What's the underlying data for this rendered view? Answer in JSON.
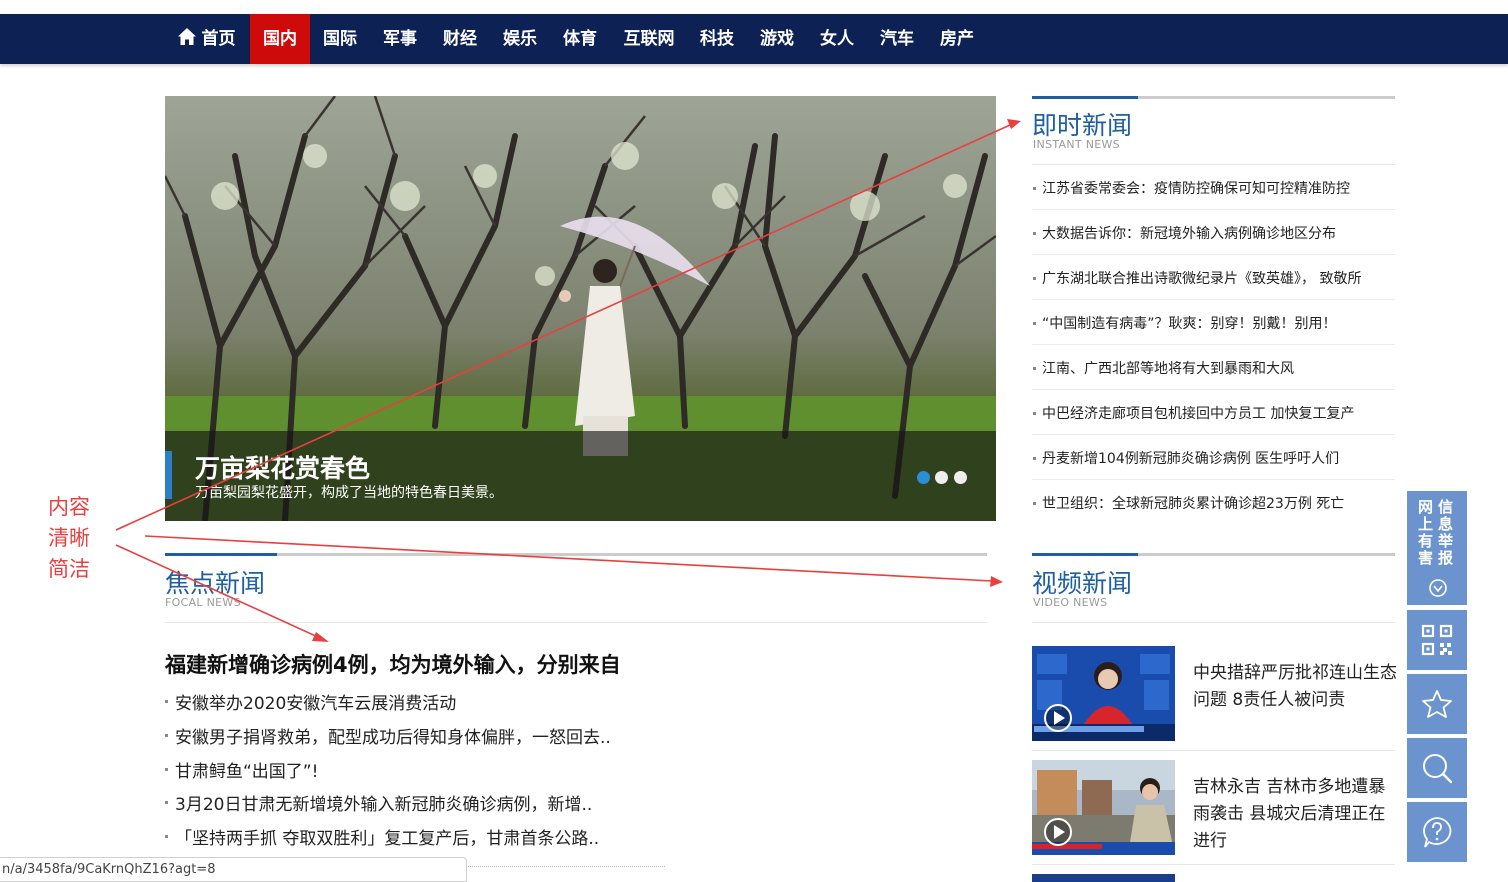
{
  "nav": {
    "items": [
      {
        "label": "首页",
        "active": false
      },
      {
        "label": "国内",
        "active": true
      },
      {
        "label": "国际",
        "active": false
      },
      {
        "label": "军事",
        "active": false
      },
      {
        "label": "财经",
        "active": false
      },
      {
        "label": "娱乐",
        "active": false
      },
      {
        "label": "体育",
        "active": false
      },
      {
        "label": "互联网",
        "active": false
      },
      {
        "label": "科技",
        "active": false
      },
      {
        "label": "游戏",
        "active": false
      },
      {
        "label": "女人",
        "active": false
      },
      {
        "label": "汽车",
        "active": false
      },
      {
        "label": "房产",
        "active": false
      }
    ],
    "bg_color": "#0d2155",
    "active_color": "#cf0a0a"
  },
  "hero": {
    "title": "万亩梨花赏春色",
    "subtitle": "万亩梨园梨花盛开，构成了当地的特色春日美景。",
    "slides_total": 3,
    "active_slide": 1
  },
  "instant": {
    "title": "即时新闻",
    "subtitle": "INSTANT NEWS",
    "items": [
      "江苏省委常委会：疫情防控确保可知可控精准防控",
      "大数据告诉你：新冠境外输入病例确诊地区分布",
      "广东湖北联合推出诗歌微纪录片《致英雄》， 致敬所",
      "“中国制造有病毒”？耿爽：别穿！别戴！别用！",
      "江南、广西北部等地将有大到暴雨和大风",
      "中巴经济走廊项目包机接回中方员工 加快复工复产",
      "丹麦新增104例新冠肺炎确诊病例 医生呼吁人们",
      "世卫组织：全球新冠肺炎累计确诊超23万例 死亡"
    ]
  },
  "focal": {
    "title": "焦点新闻",
    "subtitle": "FOCAL NEWS",
    "headline": "福建新增确诊病例4例，均为境外输入，分别来自",
    "items": [
      "安徽举办2020安徽汽车云展消费活动",
      "安徽男子捐肾救弟，配型成功后得知身体偏胖，一怒回去..",
      "甘肃鲟鱼“出国了”!",
      "3月20日甘肃无新增境外输入新冠肺炎确诊病例，新增..",
      "「坚持两手抓 夺取双胜利」复工复产后，甘肃首条公路.."
    ]
  },
  "video": {
    "title": "视频新闻",
    "subtitle": "VIDEO NEWS",
    "items": [
      {
        "title": "中央措辞严厉批祁连山生态问题 8责任人被问责",
        "thumb": "news-anchor-thumb"
      },
      {
        "title": "吉林永吉 吉林市多地遭暴雨袭击 县城灾后清理正在进行",
        "thumb": "flood-report-thumb"
      }
    ]
  },
  "sidebar": {
    "report_label": "网信上息有举害报",
    "buttons": [
      "qr-code-icon",
      "star-icon",
      "search-icon",
      "help-icon"
    ],
    "color": "#6b94cf"
  },
  "status_url": "n/a/3458fa/9CaKrnQhZ16?agt=8",
  "annotation": {
    "text": "内容清晰简洁",
    "color": "#e84040"
  }
}
